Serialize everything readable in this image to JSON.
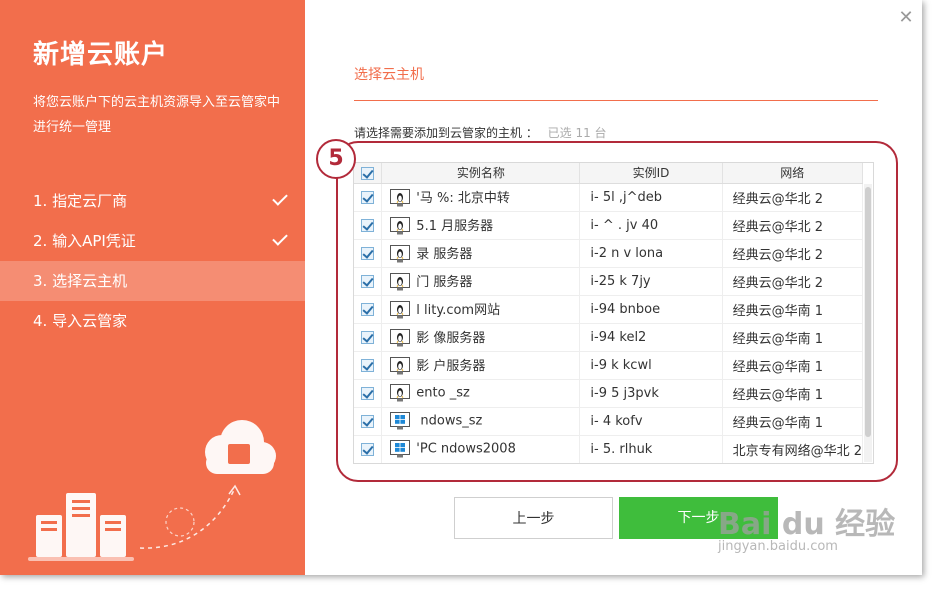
{
  "dialog": {
    "title": "新增云账户",
    "description": "将您云账户下的云主机资源导入至云管家中进行统一管理",
    "steps": [
      {
        "label": "1. 指定云厂商",
        "done": true
      },
      {
        "label": "2. 输入API凭证",
        "done": true
      },
      {
        "label": "3. 选择云主机",
        "active": true
      },
      {
        "label": "4. 导入云管家"
      }
    ],
    "close_icon": "close-icon"
  },
  "content": {
    "section_title": "选择云主机",
    "hint": "请选择需要添加到云管家的主机 ：",
    "selected_count": "已选 11 台",
    "table": {
      "headers": [
        "实例名称",
        "实例ID",
        "网络"
      ],
      "rows": [
        {
          "os": "linux",
          "name": "'马  %: 北京中转",
          "id": "i-  5l  ,j^deb",
          "network": "经典云@华北 2"
        },
        {
          "os": "linux",
          "name": "5.1 月服务器",
          "id": "i-  ^  . jv  40",
          "network": "经典云@华北 2"
        },
        {
          "os": "linux",
          "name": "录  服务器",
          "id": "i-2  n  v lona",
          "network": "经典云@华北 2"
        },
        {
          "os": "linux",
          "name": "门  服务器",
          "id": "i-25  k  7jy",
          "network": "经典云@华北 2"
        },
        {
          "os": "linux",
          "name": "l  lity.com网站",
          "id": "i-94  bnboe",
          "network": "经典云@华南 1"
        },
        {
          "os": "linux",
          "name": "影  像服务器",
          "id": "i-94  kel2",
          "network": "经典云@华南 1"
        },
        {
          "os": "linux",
          "name": "影  户服务器",
          "id": "i-9  k  kcwl",
          "network": "经典云@华南 1"
        },
        {
          "os": "linux",
          "name": "ento  _sz",
          "id": "i-9  5  j3pvk",
          "network": "经典云@华南 1"
        },
        {
          "os": "windows",
          "name": "  ndows_sz",
          "id": "i-  4  kofv",
          "network": "经典云@华南 1"
        },
        {
          "os": "windows",
          "name": "'PC  ndows2008",
          "id": "i-  5.  rlhuk",
          "network": "北京专有网络@华北 2"
        }
      ]
    }
  },
  "buttons": {
    "prev": "上一步",
    "next": "下一步"
  },
  "annotation": {
    "badge": "5"
  },
  "watermark": {
    "main": "Bai du 经验",
    "sub": "jingyan.baidu.com"
  },
  "colors": {
    "accent": "#f26e4c",
    "primary_button": "#3fbd3c",
    "annotation": "#b22a3a"
  }
}
